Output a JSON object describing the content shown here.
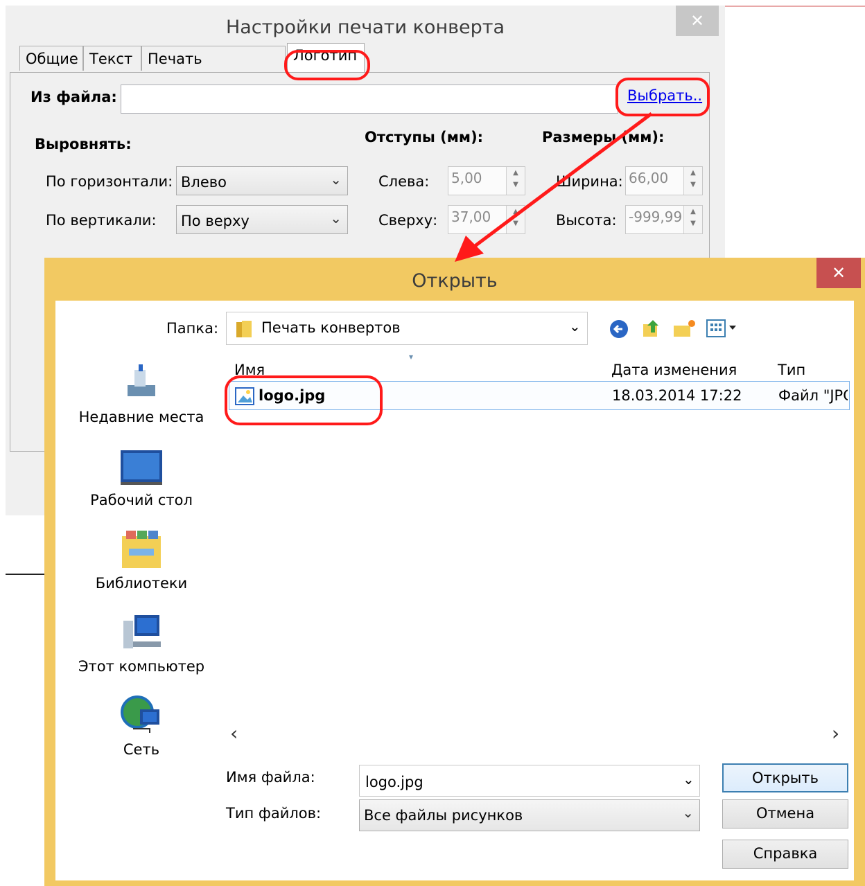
{
  "settings_dialog": {
    "title": "Настройки печати конверта",
    "close_glyph": "✕",
    "tabs": [
      {
        "label": "Общие"
      },
      {
        "label": "Текст"
      },
      {
        "label": "Печать черепицей"
      },
      {
        "label": "Логотип",
        "active": true
      }
    ],
    "from_file_label": "Из файла:",
    "from_file_value": "",
    "choose_link": "Выбрать..",
    "align": {
      "heading": "Выровнять:",
      "horizontal_label": "По горизонтали:",
      "horizontal_value": "Влево",
      "vertical_label": "По вертикали:",
      "vertical_value": "По верху"
    },
    "margins": {
      "heading": "Отступы (мм):",
      "left_label": "Слева:",
      "left_value": "5,00",
      "top_label": "Сверху:",
      "top_value": "37,00"
    },
    "sizes": {
      "heading": "Размеры (мм):",
      "width_label": "Ширина:",
      "width_value": "66,00",
      "height_label": "Высота:",
      "height_value": "-999,99"
    }
  },
  "open_dialog": {
    "title": "Открыть",
    "close_glyph": "✕",
    "folder_label": "Папка:",
    "folder_value": "Печать конвертов",
    "places": [
      {
        "label": "Недавние места",
        "icon": "recent-places-icon"
      },
      {
        "label": "Рабочий стол",
        "icon": "desktop-icon"
      },
      {
        "label": "Библиотеки",
        "icon": "libraries-icon"
      },
      {
        "label": "Этот компьютер",
        "icon": "computer-icon"
      },
      {
        "label": "Сеть",
        "icon": "network-icon"
      }
    ],
    "columns": {
      "name": "Имя",
      "date": "Дата изменения",
      "type": "Тип"
    },
    "files": [
      {
        "name": "logo.jpg",
        "date": "18.03.2014 17:22",
        "type": "Файл \"JPG"
      }
    ],
    "scroll_left": "‹",
    "scroll_right": "›",
    "filename_label": "Имя файла:",
    "filename_value": "logo.jpg",
    "filetype_label": "Тип файлов:",
    "filetype_value": "Все файлы рисунков",
    "buttons": {
      "open": "Открыть",
      "cancel": "Отмена",
      "help": "Справка"
    }
  },
  "colors": {
    "annotation": "#ff1a1a",
    "open_frame": "#f2c962",
    "link": "#0000ee"
  }
}
